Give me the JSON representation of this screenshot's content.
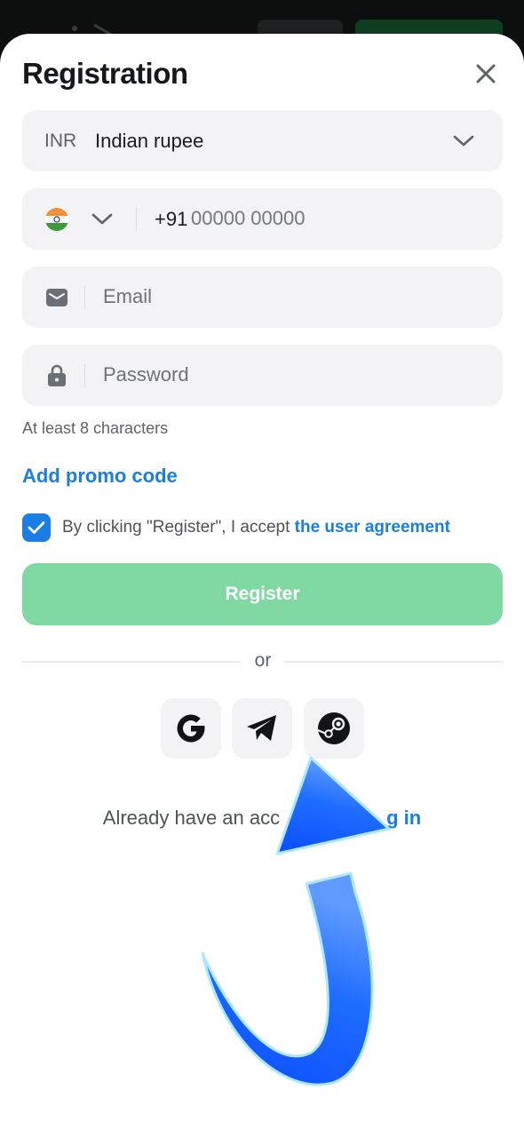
{
  "modal": {
    "title": "Registration"
  },
  "currency": {
    "code": "INR",
    "name": "Indian rupee"
  },
  "phone": {
    "prefix": "+91",
    "placeholder": "00000 00000"
  },
  "email": {
    "placeholder": "Email"
  },
  "password": {
    "placeholder": "Password",
    "hint": "At least 8 characters"
  },
  "promo": {
    "label": "Add promo code"
  },
  "agreement": {
    "checked": true,
    "text": "By clicking \"Register\", I accept ",
    "link": "the user agreement"
  },
  "register": {
    "label": "Register"
  },
  "divider": {
    "label": "or"
  },
  "social": {
    "buttons": [
      "google-icon",
      "telegram-icon",
      "steam-icon"
    ]
  },
  "login": {
    "text_visible": "Already have an acc",
    "link_visible": "g in"
  },
  "icons": [
    "close-icon",
    "chevron-down-icon",
    "india-flag-icon",
    "envelope-icon",
    "lock-icon",
    "check-icon",
    "pointer-arrow"
  ],
  "colors": {
    "accent_blue": "#1b7fe0",
    "register_green": "#80d9a2",
    "field_bg": "#f3f3f5",
    "arrow_blue": "#1f6dff"
  }
}
